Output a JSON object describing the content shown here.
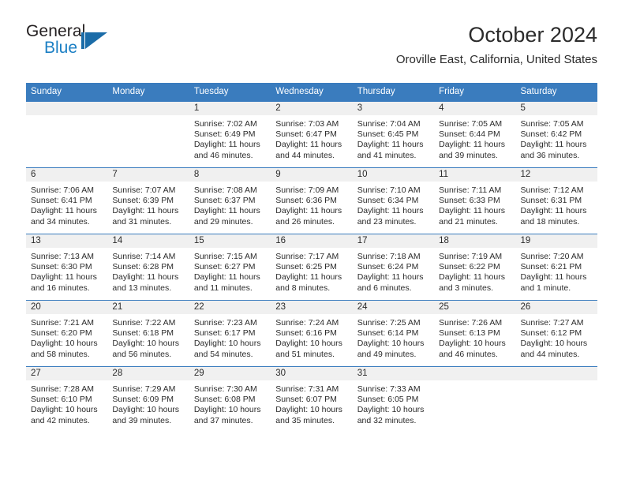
{
  "brand": {
    "name_part1": "General",
    "name_part2": "Blue",
    "logo_icon": "triangle-flag-icon",
    "accent_color": "#1b6ca8"
  },
  "header": {
    "month_title": "October 2024",
    "location": "Oroville East, California, United States"
  },
  "calendar": {
    "header_bg": "#3a7cbe",
    "daynum_bg": "#f0f0f0",
    "weekday_headers": [
      "Sunday",
      "Monday",
      "Tuesday",
      "Wednesday",
      "Thursday",
      "Friday",
      "Saturday"
    ],
    "weeks": [
      [
        {
          "day": "",
          "sunrise": "",
          "sunset": "",
          "daylight": "",
          "empty": true
        },
        {
          "day": "",
          "sunrise": "",
          "sunset": "",
          "daylight": "",
          "empty": true
        },
        {
          "day": "1",
          "sunrise": "Sunrise: 7:02 AM",
          "sunset": "Sunset: 6:49 PM",
          "daylight": "Daylight: 11 hours and 46 minutes."
        },
        {
          "day": "2",
          "sunrise": "Sunrise: 7:03 AM",
          "sunset": "Sunset: 6:47 PM",
          "daylight": "Daylight: 11 hours and 44 minutes."
        },
        {
          "day": "3",
          "sunrise": "Sunrise: 7:04 AM",
          "sunset": "Sunset: 6:45 PM",
          "daylight": "Daylight: 11 hours and 41 minutes."
        },
        {
          "day": "4",
          "sunrise": "Sunrise: 7:05 AM",
          "sunset": "Sunset: 6:44 PM",
          "daylight": "Daylight: 11 hours and 39 minutes."
        },
        {
          "day": "5",
          "sunrise": "Sunrise: 7:05 AM",
          "sunset": "Sunset: 6:42 PM",
          "daylight": "Daylight: 11 hours and 36 minutes."
        }
      ],
      [
        {
          "day": "6",
          "sunrise": "Sunrise: 7:06 AM",
          "sunset": "Sunset: 6:41 PM",
          "daylight": "Daylight: 11 hours and 34 minutes."
        },
        {
          "day": "7",
          "sunrise": "Sunrise: 7:07 AM",
          "sunset": "Sunset: 6:39 PM",
          "daylight": "Daylight: 11 hours and 31 minutes."
        },
        {
          "day": "8",
          "sunrise": "Sunrise: 7:08 AM",
          "sunset": "Sunset: 6:37 PM",
          "daylight": "Daylight: 11 hours and 29 minutes."
        },
        {
          "day": "9",
          "sunrise": "Sunrise: 7:09 AM",
          "sunset": "Sunset: 6:36 PM",
          "daylight": "Daylight: 11 hours and 26 minutes."
        },
        {
          "day": "10",
          "sunrise": "Sunrise: 7:10 AM",
          "sunset": "Sunset: 6:34 PM",
          "daylight": "Daylight: 11 hours and 23 minutes."
        },
        {
          "day": "11",
          "sunrise": "Sunrise: 7:11 AM",
          "sunset": "Sunset: 6:33 PM",
          "daylight": "Daylight: 11 hours and 21 minutes."
        },
        {
          "day": "12",
          "sunrise": "Sunrise: 7:12 AM",
          "sunset": "Sunset: 6:31 PM",
          "daylight": "Daylight: 11 hours and 18 minutes."
        }
      ],
      [
        {
          "day": "13",
          "sunrise": "Sunrise: 7:13 AM",
          "sunset": "Sunset: 6:30 PM",
          "daylight": "Daylight: 11 hours and 16 minutes."
        },
        {
          "day": "14",
          "sunrise": "Sunrise: 7:14 AM",
          "sunset": "Sunset: 6:28 PM",
          "daylight": "Daylight: 11 hours and 13 minutes."
        },
        {
          "day": "15",
          "sunrise": "Sunrise: 7:15 AM",
          "sunset": "Sunset: 6:27 PM",
          "daylight": "Daylight: 11 hours and 11 minutes."
        },
        {
          "day": "16",
          "sunrise": "Sunrise: 7:17 AM",
          "sunset": "Sunset: 6:25 PM",
          "daylight": "Daylight: 11 hours and 8 minutes."
        },
        {
          "day": "17",
          "sunrise": "Sunrise: 7:18 AM",
          "sunset": "Sunset: 6:24 PM",
          "daylight": "Daylight: 11 hours and 6 minutes."
        },
        {
          "day": "18",
          "sunrise": "Sunrise: 7:19 AM",
          "sunset": "Sunset: 6:22 PM",
          "daylight": "Daylight: 11 hours and 3 minutes."
        },
        {
          "day": "19",
          "sunrise": "Sunrise: 7:20 AM",
          "sunset": "Sunset: 6:21 PM",
          "daylight": "Daylight: 11 hours and 1 minute."
        }
      ],
      [
        {
          "day": "20",
          "sunrise": "Sunrise: 7:21 AM",
          "sunset": "Sunset: 6:20 PM",
          "daylight": "Daylight: 10 hours and 58 minutes."
        },
        {
          "day": "21",
          "sunrise": "Sunrise: 7:22 AM",
          "sunset": "Sunset: 6:18 PM",
          "daylight": "Daylight: 10 hours and 56 minutes."
        },
        {
          "day": "22",
          "sunrise": "Sunrise: 7:23 AM",
          "sunset": "Sunset: 6:17 PM",
          "daylight": "Daylight: 10 hours and 54 minutes."
        },
        {
          "day": "23",
          "sunrise": "Sunrise: 7:24 AM",
          "sunset": "Sunset: 6:16 PM",
          "daylight": "Daylight: 10 hours and 51 minutes."
        },
        {
          "day": "24",
          "sunrise": "Sunrise: 7:25 AM",
          "sunset": "Sunset: 6:14 PM",
          "daylight": "Daylight: 10 hours and 49 minutes."
        },
        {
          "day": "25",
          "sunrise": "Sunrise: 7:26 AM",
          "sunset": "Sunset: 6:13 PM",
          "daylight": "Daylight: 10 hours and 46 minutes."
        },
        {
          "day": "26",
          "sunrise": "Sunrise: 7:27 AM",
          "sunset": "Sunset: 6:12 PM",
          "daylight": "Daylight: 10 hours and 44 minutes."
        }
      ],
      [
        {
          "day": "27",
          "sunrise": "Sunrise: 7:28 AM",
          "sunset": "Sunset: 6:10 PM",
          "daylight": "Daylight: 10 hours and 42 minutes."
        },
        {
          "day": "28",
          "sunrise": "Sunrise: 7:29 AM",
          "sunset": "Sunset: 6:09 PM",
          "daylight": "Daylight: 10 hours and 39 minutes."
        },
        {
          "day": "29",
          "sunrise": "Sunrise: 7:30 AM",
          "sunset": "Sunset: 6:08 PM",
          "daylight": "Daylight: 10 hours and 37 minutes."
        },
        {
          "day": "30",
          "sunrise": "Sunrise: 7:31 AM",
          "sunset": "Sunset: 6:07 PM",
          "daylight": "Daylight: 10 hours and 35 minutes."
        },
        {
          "day": "31",
          "sunrise": "Sunrise: 7:33 AM",
          "sunset": "Sunset: 6:05 PM",
          "daylight": "Daylight: 10 hours and 32 minutes."
        },
        {
          "day": "",
          "sunrise": "",
          "sunset": "",
          "daylight": "",
          "empty": true
        },
        {
          "day": "",
          "sunrise": "",
          "sunset": "",
          "daylight": "",
          "empty": true
        }
      ]
    ]
  }
}
